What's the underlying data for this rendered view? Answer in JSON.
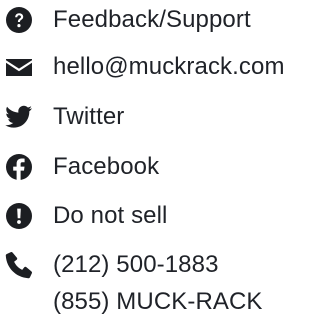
{
  "contacts": {
    "feedback": {
      "label": "Feedback/Support",
      "icon": "question-circle-icon"
    },
    "email": {
      "label": "hello@muckrack.com",
      "icon": "envelope-icon"
    },
    "twitter": {
      "label": "Twitter",
      "icon": "twitter-bird-icon"
    },
    "facebook": {
      "label": "Facebook",
      "icon": "facebook-icon"
    },
    "do_not_sell": {
      "label": "Do not sell",
      "icon": "exclamation-circle-icon"
    },
    "phone": {
      "icon": "phone-icon",
      "line1": "(212) 500-1883",
      "line2": "(855) MUCK-RACK"
    }
  },
  "colors": {
    "icon": "#1c1e22",
    "text": "#1f2228"
  }
}
